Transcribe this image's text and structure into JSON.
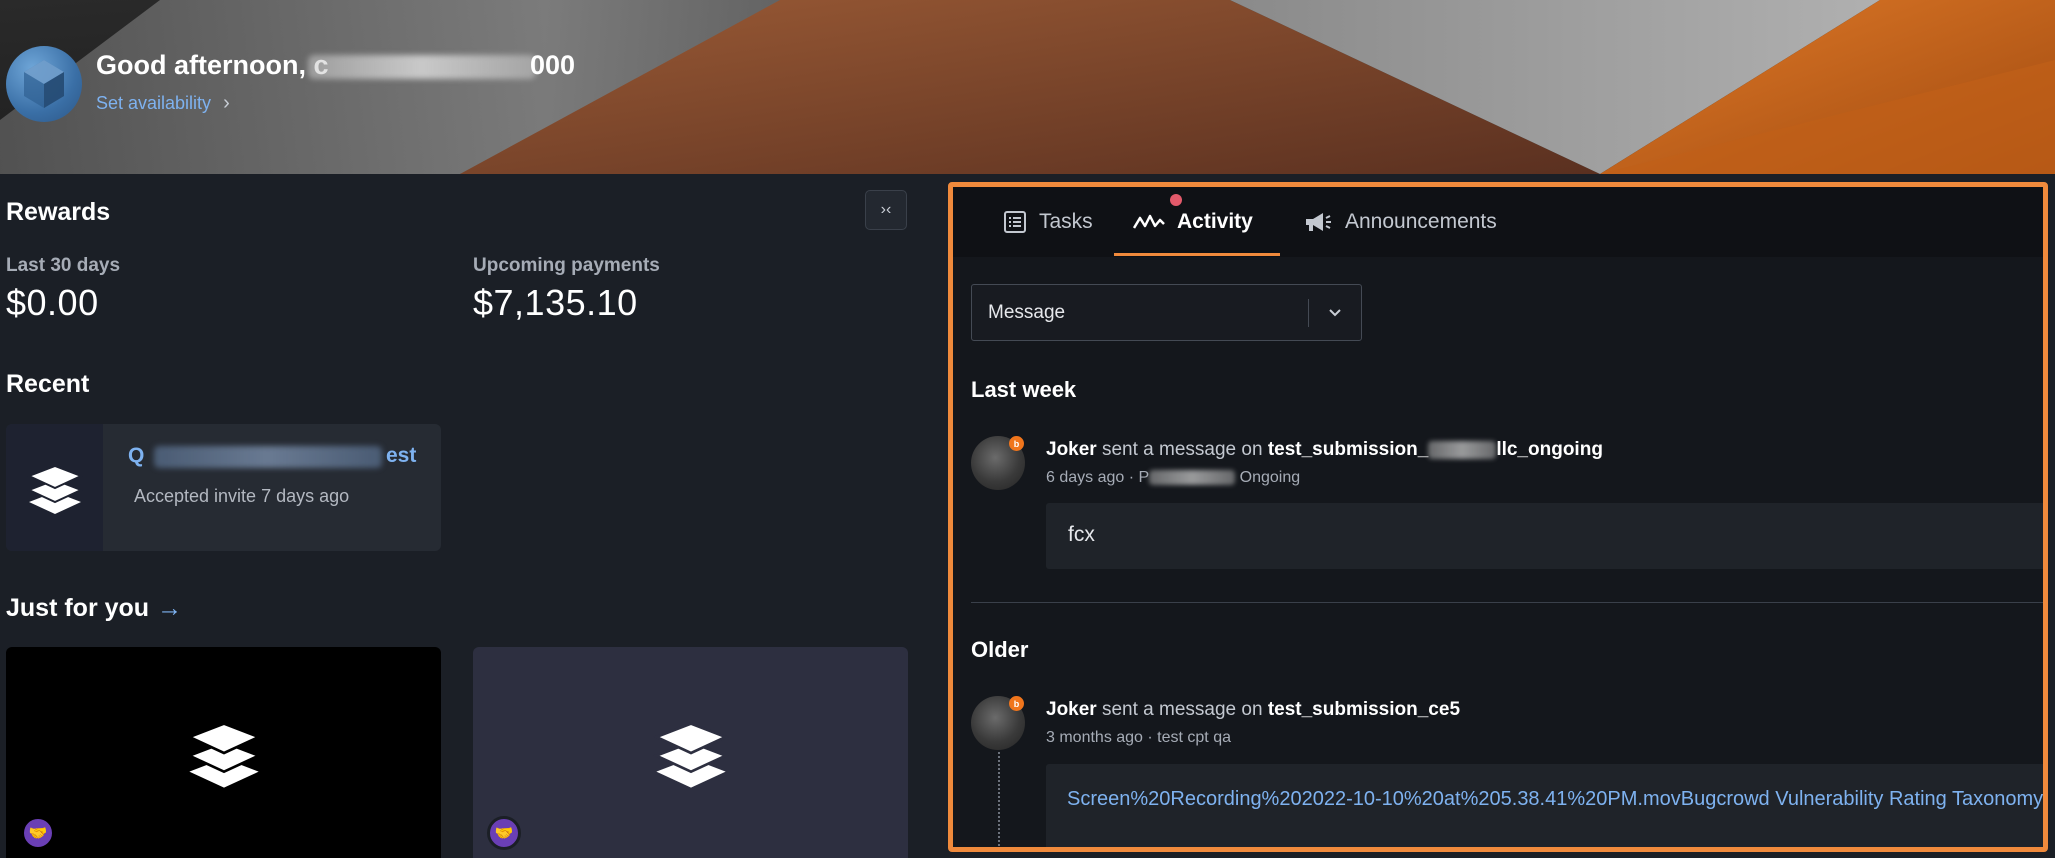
{
  "header": {
    "greeting_prefix": "Good afternoon, ",
    "greeting_visible_start": "c",
    "greeting_suffix": "000",
    "availability_label": "Set availability"
  },
  "rewards": {
    "title": "Rewards",
    "last30_label": "Last 30 days",
    "last30_value": "$0.00",
    "upcoming_label": "Upcoming payments",
    "upcoming_value": "$7,135.10"
  },
  "recent": {
    "title": "Recent",
    "card": {
      "title_start": "Q",
      "title_end": "est",
      "subtitle": "Accepted invite 7 days ago"
    }
  },
  "just_for_you": {
    "title": "Just for you",
    "arrow": "→"
  },
  "activity_panel": {
    "tabs": [
      {
        "label": "Tasks",
        "icon": "list-icon"
      },
      {
        "label": "Activity",
        "icon": "activity-icon"
      },
      {
        "label": "Announcements",
        "icon": "megaphone-icon"
      }
    ],
    "filter": {
      "value": "Message"
    },
    "groups": [
      {
        "title": "Last week",
        "item": {
          "actor": "Joker",
          "action": " sent a message on ",
          "target_start": "test_submission_",
          "target_end": "llc_ongoing",
          "time": "6 days ago",
          "meta_start": "P",
          "meta_end": "Ongoing",
          "message": "fcx"
        }
      },
      {
        "title": "Older",
        "item": {
          "actor": "Joker",
          "action": " sent a message on ",
          "target": "test_submission_ce5",
          "time": "3 months ago",
          "meta": "test cpt qa",
          "message": "Screen%20Recording%202022-10-10%20at%205.38.41%20PM.movBugcrowd Vulnerability Rating Taxonomy"
        }
      }
    ]
  },
  "colors": {
    "accent": "#f08a3c",
    "link": "#7eb2f0",
    "badge": "#f0751c",
    "notification": "#e35a6b"
  }
}
